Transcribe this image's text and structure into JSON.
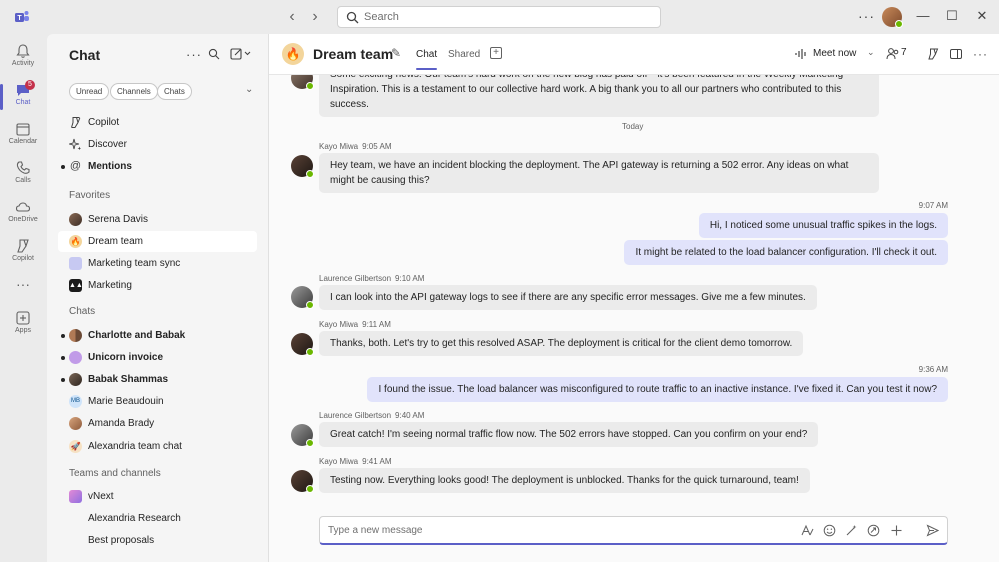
{
  "titlebar": {
    "search_placeholder": "Search",
    "more": "···"
  },
  "rail": [
    {
      "label": "Activity",
      "icon": "bell-icon"
    },
    {
      "label": "Chat",
      "icon": "chat-icon",
      "badge": "5"
    },
    {
      "label": "Calendar",
      "icon": "calendar-icon"
    },
    {
      "label": "Calls",
      "icon": "phone-icon"
    },
    {
      "label": "OneDrive",
      "icon": "cloud-icon"
    },
    {
      "label": "Copilot",
      "icon": "copilot-icon"
    },
    {
      "label": "Apps",
      "icon": "apps-icon"
    }
  ],
  "listpane": {
    "title": "Chat",
    "filters": [
      "Unread",
      "Channels",
      "Chats"
    ],
    "top_items": [
      "Copilot",
      "Discover",
      "Mentions"
    ],
    "favorites_heading": "Favorites",
    "favorites": [
      "Serena Davis",
      "Dream team",
      "Marketing team sync",
      "Marketing"
    ],
    "chats_heading": "Chats",
    "chats": [
      "Charlotte and Babak",
      "Unicorn invoice",
      "Babak Shammas",
      "Marie Beaudouin",
      "Amanda Brady",
      "Alexandria team chat"
    ],
    "teams_heading": "Teams and channels",
    "teams": [
      "vNext",
      "Alexandria Research",
      "Best proposals"
    ],
    "marie_initials": "MB"
  },
  "header": {
    "title": "Dream team",
    "tabs": [
      "Chat",
      "Shared"
    ],
    "meet_label": "Meet now",
    "people_count": "7"
  },
  "messages": {
    "partial_text": "Some exciting news: Our team's hard work on the new blog has paid off—it's been featured in the Weekly Marketing Inspiration. This is a testament to our collective hard work. A big thank you to all our partners who contributed to this success.",
    "day_divider": "Today",
    "list": [
      {
        "sender": "Kayo Miwa",
        "time": "9:05 AM",
        "text": "Hey team, we have an incident blocking the deployment. The API gateway is returning a 502 error. Any ideas on what might be causing this?"
      },
      {
        "sender": "",
        "time": "9:07 AM",
        "text": "Hi, I noticed some unusual traffic spikes in the logs."
      },
      {
        "sender": "",
        "time": "",
        "text": "It might be related to the load balancer configuration. I'll check it out."
      },
      {
        "sender": "Laurence Gilbertson",
        "time": "9:10 AM",
        "text": "I can look into the API gateway logs to see if there are any specific error messages. Give me a few minutes."
      },
      {
        "sender": "Kayo Miwa",
        "time": "9:11 AM",
        "text": "Thanks, both. Let's try to get this resolved ASAP. The deployment is critical for the client demo tomorrow."
      },
      {
        "sender": "",
        "time": "9:36 AM",
        "text": "I found the issue. The load balancer was misconfigured to route traffic to an inactive instance. I've fixed it. Can you test it now?"
      },
      {
        "sender": "Laurence Gilbertson",
        "time": "9:40 AM",
        "text": "Great catch! I'm seeing normal traffic flow now. The 502 errors have stopped. Can you confirm on your end?"
      },
      {
        "sender": "Kayo Miwa",
        "time": "9:41 AM",
        "text": "Testing now. Everything looks good! The deployment is unblocked. Thanks for the quick turnaround, team!"
      }
    ]
  },
  "composer": {
    "placeholder": "Type a new message"
  },
  "colors": {
    "accent": "#5b5fc7",
    "my_bubble": "#e1e3fb",
    "their_bubble": "#ebebeb",
    "presence": "#6bb700",
    "badge": "#c4314b"
  }
}
